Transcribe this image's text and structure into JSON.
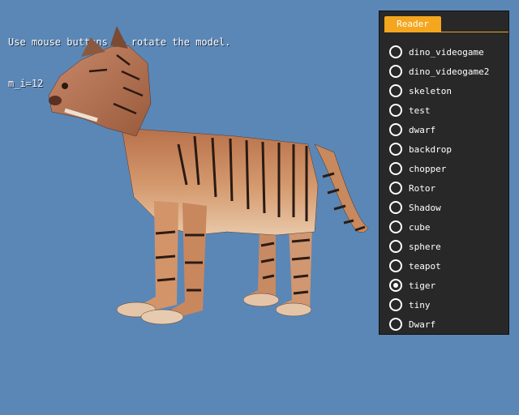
{
  "hud": {
    "instruction": "Use mouse buttons to rotate the model.",
    "counter": "m_i=12"
  },
  "panel": {
    "tab_label": "Reader",
    "items": [
      {
        "label": "dino_videogame",
        "selected": false
      },
      {
        "label": "dino_videogame2",
        "selected": false
      },
      {
        "label": "skeleton",
        "selected": false
      },
      {
        "label": "test",
        "selected": false
      },
      {
        "label": "dwarf",
        "selected": false
      },
      {
        "label": "backdrop",
        "selected": false
      },
      {
        "label": "chopper",
        "selected": false
      },
      {
        "label": "Rotor",
        "selected": false
      },
      {
        "label": "Shadow",
        "selected": false
      },
      {
        "label": "cube",
        "selected": false
      },
      {
        "label": "sphere",
        "selected": false
      },
      {
        "label": "teapot",
        "selected": false
      },
      {
        "label": "tiger",
        "selected": true
      },
      {
        "label": "tiny",
        "selected": false
      },
      {
        "label": "Dwarf",
        "selected": false
      }
    ]
  },
  "colors": {
    "background": "#5b87b6",
    "panel": "#282828",
    "accent": "#f3a61e"
  }
}
